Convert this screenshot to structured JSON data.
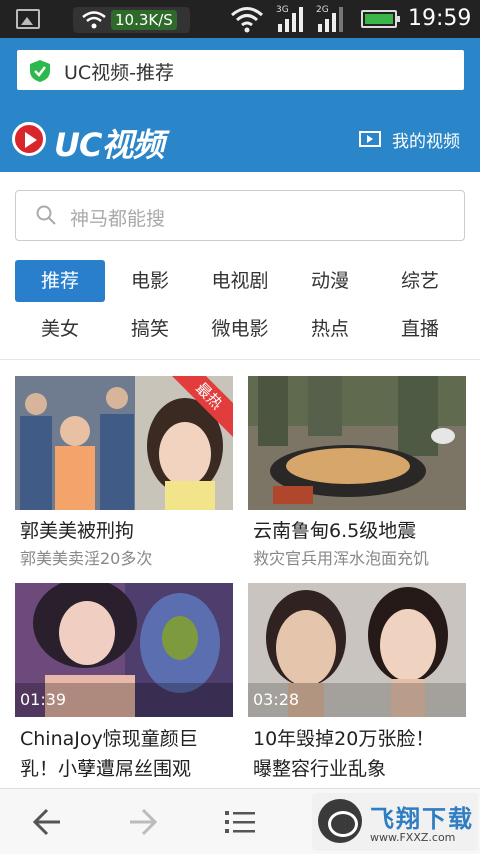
{
  "status_bar": {
    "speed": "10.3K/S",
    "network_labels": [
      "3G",
      "2G"
    ],
    "time": "19:59",
    "icons": [
      "image-icon",
      "wifi-icon",
      "signal-icon",
      "battery-icon"
    ]
  },
  "url_bar": {
    "text": "UC视频-推荐",
    "icon": "shield-check-icon"
  },
  "header": {
    "logo_text": "UC视频",
    "my_video_label": "我的视频"
  },
  "search": {
    "placeholder": "神马都能搜"
  },
  "categories": [
    "推荐",
    "电影",
    "电视剧",
    "动漫",
    "综艺",
    "美女",
    "搞笑",
    "微电影",
    "热点",
    "直播"
  ],
  "active_category": "推荐",
  "cards": [
    {
      "title": "郭美美被刑拘",
      "subtitle": "郭美美卖淫20多次",
      "badge": "最热",
      "duration": ""
    },
    {
      "title": "云南鲁甸6.5级地震",
      "subtitle": "救灾官兵用浑水泡面充饥",
      "badge": "",
      "duration": ""
    },
    {
      "title": "ChinaJoy惊现童颜巨",
      "subtitle": "乳！小孽遭屌丝围观",
      "badge": "",
      "duration": "01:39"
    },
    {
      "title": "10年毁掉20万张脸！",
      "subtitle": "曝整容行业乱象",
      "badge": "",
      "duration": "03:28"
    }
  ],
  "bottom_nav": {
    "buttons": [
      "back-arrow-icon",
      "forward-arrow-icon",
      "menu-icon"
    ],
    "watermark": {
      "text": "飞翔下载",
      "url": "www.FXXZ.com"
    }
  },
  "colors": {
    "accent": "#2a86c8",
    "active_tab": "#2a7fcd",
    "hot_badge": "#e23c3c"
  }
}
